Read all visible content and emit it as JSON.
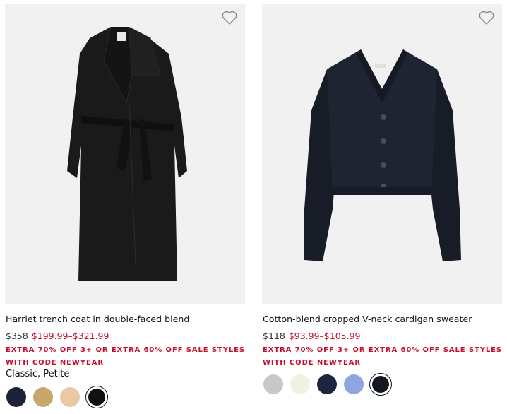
{
  "products": [
    {
      "name": "Harriet trench coat in double-faced blend",
      "original_price": "$358",
      "sale_price": "$199.99–$321.99",
      "promo": "EXTRA 70% OFF 3+ OR EXTRA 60% OFF SALE STYLES WITH CODE NEWYEAR",
      "fit": "Classic, Petite",
      "favorite_icon": "heart-outline-icon",
      "swatches": [
        {
          "color": "#1b2238",
          "selected": false
        },
        {
          "color": "#c9a66b",
          "selected": false
        },
        {
          "color": "#e9c9a4",
          "selected": false
        },
        {
          "color": "#111111",
          "selected": true
        }
      ]
    },
    {
      "name": "Cotton-blend cropped V-neck cardigan sweater",
      "original_price": "$118",
      "sale_price": "$93.99–$105.99",
      "promo": "EXTRA 70% OFF 3+ OR EXTRA 60% OFF SALE STYLES WITH CODE NEWYEAR",
      "favorite_icon": "heart-outline-icon",
      "swatches": [
        {
          "color": "#c8c8c8",
          "selected": false
        },
        {
          "color": "#f2efe3",
          "selected": false
        },
        {
          "color": "#1d2540",
          "selected": false
        },
        {
          "color": "#8ea6e0",
          "selected": false
        },
        {
          "color": "#141821",
          "selected": true
        }
      ]
    }
  ],
  "colors": {
    "sale": "#c4102c",
    "image_bg": "#f1f1f1"
  }
}
